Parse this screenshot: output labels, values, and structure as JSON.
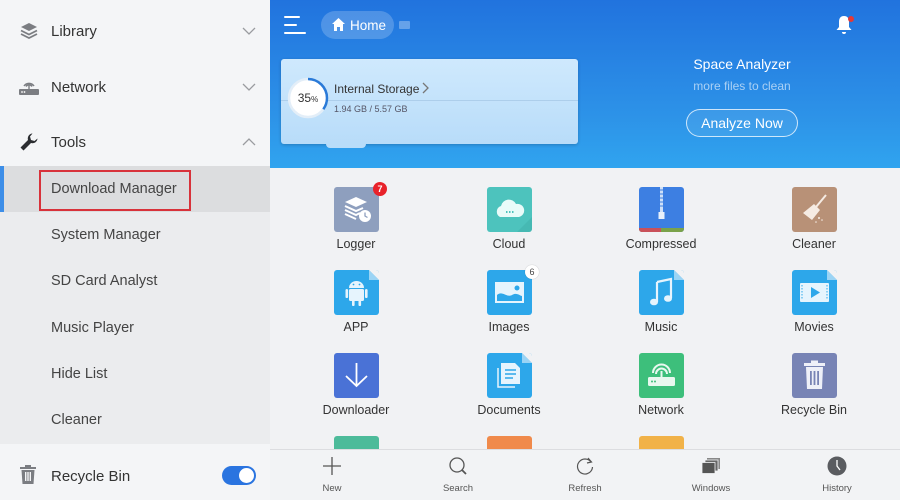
{
  "sidebar": {
    "sections": [
      {
        "label": "Library",
        "icon": "layers-icon",
        "expanded": false
      },
      {
        "label": "Network",
        "icon": "router-icon",
        "expanded": false
      },
      {
        "label": "Tools",
        "icon": "wrench-icon",
        "expanded": true
      }
    ],
    "tools_items": [
      {
        "label": "Download Manager",
        "active": true
      },
      {
        "label": "System Manager"
      },
      {
        "label": "SD Card Analyst"
      },
      {
        "label": "Music Player"
      },
      {
        "label": "Hide List"
      },
      {
        "label": "Cleaner"
      }
    ],
    "recycle_bin": {
      "label": "Recycle Bin",
      "icon": "trash-icon",
      "toggle_on": true
    }
  },
  "header": {
    "breadcrumb_home": "Home",
    "storage": {
      "title": "Internal Storage",
      "percent": "35",
      "percent_sign": "%",
      "usage_fraction": 0.35,
      "size": "1.94 GB / 5.57 GB"
    },
    "analyzer": {
      "title": "Space Analyzer",
      "subtitle": "more files to clean",
      "button": "Analyze Now"
    }
  },
  "grid": {
    "tiles": [
      {
        "label": "Logger",
        "icon": "logger-icon",
        "badge": "7",
        "color": "#8e9fbe"
      },
      {
        "label": "Cloud",
        "icon": "cloud-icon",
        "color": "#4dc3bd"
      },
      {
        "label": "Compressed",
        "icon": "zip-icon",
        "color": "#3d7fe2"
      },
      {
        "label": "Cleaner",
        "icon": "broom-icon",
        "color": "#b89177"
      },
      {
        "label": "APP",
        "icon": "android-icon",
        "color": "#2da7ea"
      },
      {
        "label": "Images",
        "icon": "image-icon",
        "badge": "6",
        "color": "#2da7ea"
      },
      {
        "label": "Music",
        "icon": "music-icon",
        "color": "#2da7ea"
      },
      {
        "label": "Movies",
        "icon": "movie-icon",
        "color": "#2da7ea"
      },
      {
        "label": "Downloader",
        "icon": "download-icon",
        "color": "#4a72d6"
      },
      {
        "label": "Documents",
        "icon": "document-icon",
        "color": "#2da7ea"
      },
      {
        "label": "Network",
        "icon": "router-icon",
        "color": "#3dbf7b"
      },
      {
        "label": "Recycle Bin",
        "icon": "trash-icon",
        "color": "#7884b5"
      }
    ],
    "partial_colors": [
      "#4dbb9a",
      "#f08a4b",
      "#f1b248"
    ]
  },
  "bottombar": {
    "items": [
      {
        "label": "New",
        "icon": "plus-icon"
      },
      {
        "label": "Search",
        "icon": "search-icon"
      },
      {
        "label": "Refresh",
        "icon": "refresh-icon"
      },
      {
        "label": "Windows",
        "icon": "windows-icon"
      },
      {
        "label": "History",
        "icon": "clock-icon"
      }
    ]
  }
}
